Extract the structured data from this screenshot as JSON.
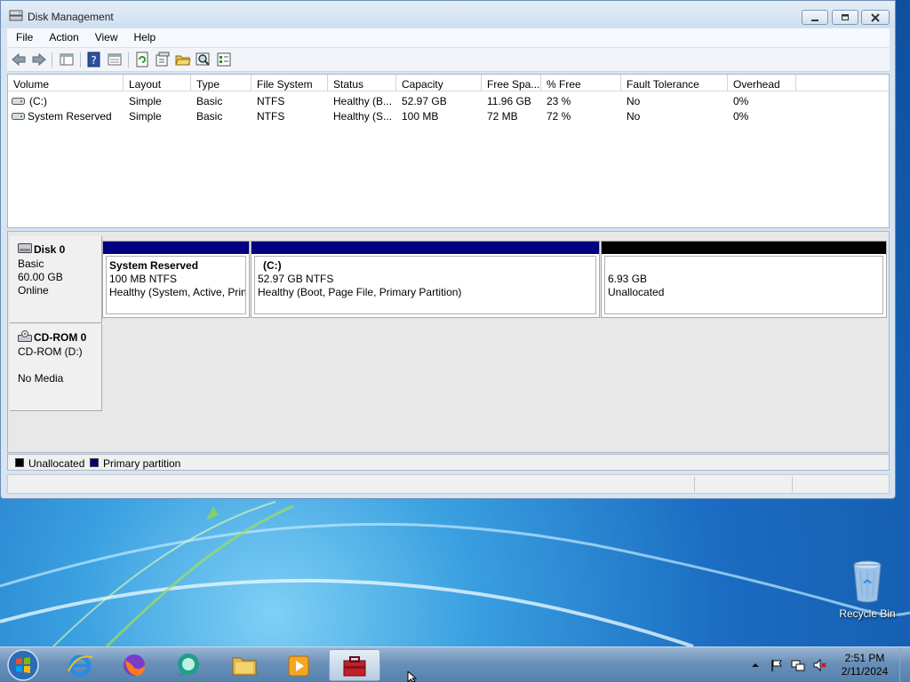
{
  "window": {
    "title": "Disk Management"
  },
  "menu": [
    "File",
    "Action",
    "View",
    "Help"
  ],
  "volume_table": {
    "columns": [
      "Volume",
      "Layout",
      "Type",
      "File System",
      "Status",
      "Capacity",
      "Free Spa...",
      "% Free",
      "Fault Tolerance",
      "Overhead"
    ],
    "rows": [
      [
        "(C:)",
        "Simple",
        "Basic",
        "NTFS",
        "Healthy (B...",
        "52.97 GB",
        "11.96 GB",
        "23 %",
        "No",
        "0%"
      ],
      [
        "System Reserved",
        "Simple",
        "Basic",
        "NTFS",
        "Healthy (S...",
        "100 MB",
        "72 MB",
        "72 %",
        "No",
        "0%"
      ]
    ]
  },
  "disk0": {
    "name": "Disk 0",
    "type": "Basic",
    "size": "60.00 GB",
    "state": "Online",
    "partitions": [
      {
        "name": "System Reserved",
        "size": "100 MB NTFS",
        "status": "Healthy (System, Active, Prin",
        "kind": "primary"
      },
      {
        "name": "(C:)",
        "size": "52.97 GB NTFS",
        "status": "Healthy (Boot, Page File, Primary Partition)",
        "kind": "primary"
      },
      {
        "name": "",
        "size": "6.93 GB",
        "status": "Unallocated",
        "kind": "unallocated"
      }
    ]
  },
  "cdrom0": {
    "name": "CD-ROM 0",
    "drive": "CD-ROM (D:)",
    "media": "No Media"
  },
  "legend": [
    {
      "label": "Unallocated",
      "color": "#000000"
    },
    {
      "label": "Primary partition",
      "color": "#000080"
    }
  ],
  "desktop": {
    "recycle_bin": "Recycle Bin"
  },
  "taskbar": {
    "time": "2:51 PM",
    "date": "2/11/2024"
  },
  "colors": {
    "primary_partition": "#000080",
    "unallocated": "#000000",
    "accent": "#1f6fc4"
  }
}
